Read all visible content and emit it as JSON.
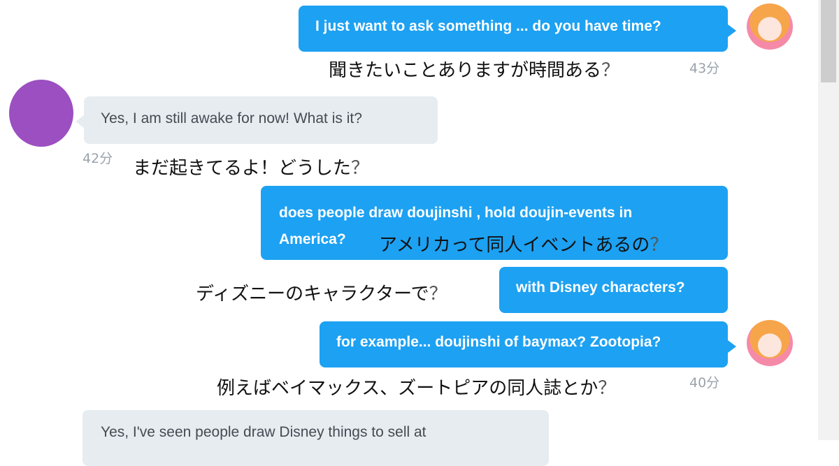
{
  "colors": {
    "outgoing_bubble": "#1da1f2",
    "incoming_bubble": "#e6ecf0",
    "incoming_avatar": "#9b4fc0",
    "timestamp": "#9aa3ab"
  },
  "messages": [
    {
      "direction": "outgoing",
      "text": "I just want to ask something ... do you have time?",
      "translation_main": "聞きたいことありますが時間ある",
      "translation_mark": "？",
      "time": "43分"
    },
    {
      "direction": "incoming",
      "text": "Yes, I am still awake for now! What is it?",
      "translation_main": "まだ起きてるよ！どうした",
      "translation_mark": "？",
      "time": "42分"
    },
    {
      "direction": "outgoing",
      "text_line1": "does people draw doujinshi , hold doujin-events in",
      "text_line2": "America?",
      "translation_main": "アメリカって同人イベントあるの",
      "translation_mark": "？"
    },
    {
      "direction": "outgoing",
      "text": "with Disney characters?",
      "translation_main": "ディズニーのキャラクターで",
      "translation_mark": "？"
    },
    {
      "direction": "outgoing",
      "text": "for example... doujinshi of baymax? Zootopia?",
      "translation_main": "例えばベイマックス、ズートピアの同人誌とか",
      "translation_mark": "？",
      "time": "40分"
    },
    {
      "direction": "incoming",
      "text": "Yes, I've seen people draw Disney things to sell at"
    }
  ],
  "avatars": {
    "outgoing_icon": "anime-girl-avatar",
    "incoming_icon": "purple-circle-avatar"
  }
}
